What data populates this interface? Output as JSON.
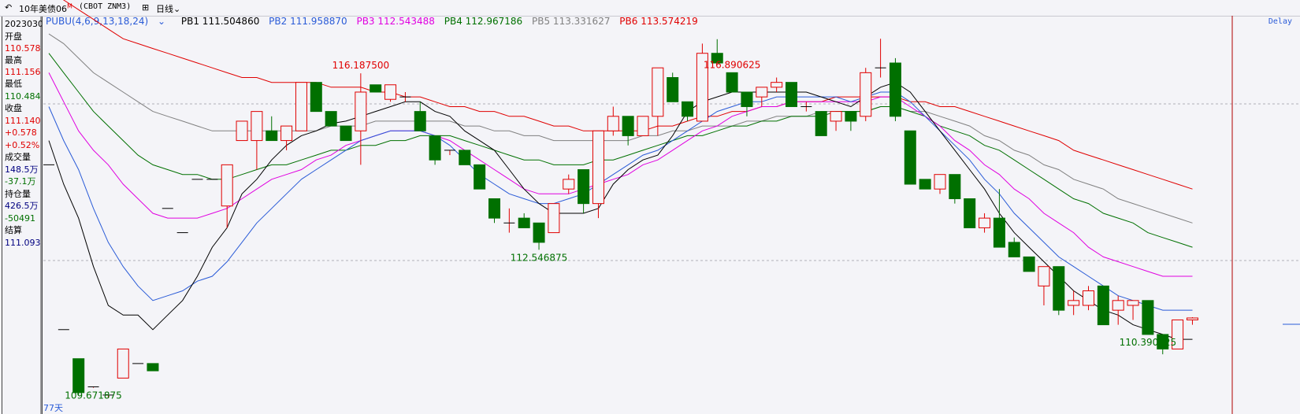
{
  "titlebar": {
    "back_glyph": "↶",
    "symbol": "10年美债06",
    "symbol_sup": "M",
    "code": "(CBOT ZNM3)",
    "grid_glyph": "⊞",
    "period": "日线",
    "period_arrow": "⌄"
  },
  "info_panel": {
    "date": "20230303",
    "open_label": "开盘",
    "open_value": "110.578",
    "high_label": "最高",
    "high_value": "111.156",
    "low_label": "最低",
    "low_value": "110.484",
    "close_label": "收盘",
    "close_value": "111.140",
    "change": "+0.578",
    "change_pct": "+0.52%",
    "volume_label": "成交量",
    "volume_value": "148.5万",
    "volume_change": "-37.1万",
    "oi_label": "持仓量",
    "oi_value": "426.5万",
    "oi_change": "-50491",
    "settle_label": "结算",
    "settle_value": "111.093"
  },
  "legend": {
    "indicator": "PUBU(4,6,9,13,18,24)",
    "items": [
      {
        "label": "PB1 111.504860",
        "color": "#000000"
      },
      {
        "label": "PB2 111.958870",
        "color": "#2a5bd7"
      },
      {
        "label": "PB3 112.543488",
        "color": "#e000e0"
      },
      {
        "label": "PB4 112.967186",
        "color": "#007000"
      },
      {
        "label": "PB5 113.331627",
        "color": "#808080"
      },
      {
        "label": "PB6 113.574219",
        "color": "#e00000"
      }
    ]
  },
  "delay_label": "Delay",
  "days_label": "77天",
  "colors": {
    "up": "#e00000",
    "down": "#007000",
    "pb1": "#000000",
    "pb2": "#2a5bd7",
    "pb3": "#e000e0",
    "pb4": "#007000",
    "pb5": "#808080",
    "pb6": "#e00000",
    "crosshair": "#b00000"
  },
  "chart_data": {
    "type": "candlestick",
    "price_range": [
      109.5,
      117.05
    ],
    "annotations": [
      {
        "label": "116.187500",
        "candle": 21,
        "kind": "high",
        "color": "#e00000"
      },
      {
        "label": "112.546875",
        "candle": 33,
        "kind": "low",
        "color": "#007000"
      },
      {
        "label": "116.890625",
        "candle": 46,
        "kind": "high",
        "color": "#e00000"
      },
      {
        "label": "109.671875",
        "candle": 3,
        "kind": "low",
        "color": "#007000"
      },
      {
        "label": "110.390625",
        "candle": 74,
        "kind": "low",
        "color": "#007000"
      }
    ],
    "candles": [
      [
        114.3,
        114.3,
        114.3,
        114.3
      ],
      [
        110.9,
        110.9,
        110.9,
        110.9
      ],
      [
        110.3,
        110.3,
        109.55,
        109.6
      ],
      [
        109.72,
        109.72,
        109.7,
        109.72
      ],
      [
        109.55,
        109.55,
        109.5,
        109.55
      ],
      [
        109.9,
        110.5,
        109.9,
        110.5
      ],
      [
        110.2,
        110.2,
        110.2,
        110.2
      ],
      [
        110.2,
        110.2,
        110.05,
        110.05
      ],
      [
        113.4,
        113.4,
        113.4,
        113.4
      ],
      [
        112.9,
        112.9,
        112.9,
        112.9
      ],
      [
        114.0,
        114.0,
        114.0,
        114.0
      ],
      [
        114.0,
        114.0,
        114.0,
        114.0
      ],
      [
        113.45,
        114.3,
        113.0,
        114.3
      ],
      [
        114.8,
        115.2,
        114.8,
        115.2
      ],
      [
        114.8,
        115.4,
        114.2,
        115.4
      ],
      [
        115.0,
        115.3,
        114.8,
        114.8
      ],
      [
        114.8,
        115.1,
        114.6,
        115.1
      ],
      [
        115.0,
        116.0,
        115.0,
        116.0
      ],
      [
        116.0,
        116.0,
        115.4,
        115.4
      ],
      [
        115.4,
        115.4,
        115.1,
        115.1
      ],
      [
        115.1,
        115.1,
        114.8,
        114.8
      ],
      [
        115.0,
        116.187,
        114.3,
        115.8
      ],
      [
        115.95,
        115.95,
        115.8,
        115.8
      ],
      [
        115.65,
        115.95,
        115.6,
        115.95
      ],
      [
        115.7,
        115.8,
        115.6,
        115.7
      ],
      [
        115.4,
        115.6,
        115.0,
        115.0
      ],
      [
        114.9,
        114.9,
        114.3,
        114.4
      ],
      [
        114.6,
        114.6,
        114.5,
        114.6
      ],
      [
        114.6,
        114.6,
        114.3,
        114.3
      ],
      [
        114.3,
        114.3,
        113.8,
        113.8
      ],
      [
        113.6,
        113.6,
        113.1,
        113.2
      ],
      [
        113.1,
        113.4,
        112.9,
        113.1
      ],
      [
        113.2,
        113.3,
        113.0,
        113.0
      ],
      [
        113.1,
        113.1,
        112.547,
        112.7
      ],
      [
        112.9,
        113.5,
        112.9,
        113.5
      ],
      [
        113.8,
        114.1,
        113.7,
        114.0
      ],
      [
        114.2,
        114.2,
        113.3,
        113.5
      ],
      [
        113.5,
        115.0,
        113.2,
        115.0
      ],
      [
        115.0,
        115.5,
        114.9,
        115.3
      ],
      [
        115.3,
        115.3,
        114.7,
        114.9
      ],
      [
        114.9,
        115.3,
        114.9,
        115.3
      ],
      [
        115.3,
        116.3,
        114.9,
        116.3
      ],
      [
        116.1,
        116.2,
        115.6,
        115.6
      ],
      [
        115.6,
        115.6,
        115.2,
        115.3
      ],
      [
        115.2,
        116.8,
        115.2,
        116.6
      ],
      [
        116.6,
        116.891,
        116.4,
        116.4
      ],
      [
        116.2,
        116.2,
        115.8,
        115.8
      ],
      [
        115.8,
        115.8,
        115.3,
        115.5
      ],
      [
        115.7,
        115.9,
        115.5,
        115.9
      ],
      [
        115.9,
        116.1,
        115.8,
        116.0
      ],
      [
        116.0,
        116.0,
        115.5,
        115.5
      ],
      [
        115.5,
        115.6,
        115.4,
        115.5
      ],
      [
        115.4,
        115.4,
        114.9,
        114.9
      ],
      [
        115.2,
        115.4,
        115.0,
        115.4
      ],
      [
        115.4,
        115.4,
        115.0,
        115.2
      ],
      [
        115.3,
        116.3,
        115.2,
        116.2
      ],
      [
        116.3,
        116.9,
        116.1,
        116.3
      ],
      [
        116.4,
        116.5,
        115.2,
        115.3
      ],
      [
        115.0,
        115.0,
        113.9,
        113.9
      ],
      [
        114.0,
        114.0,
        113.8,
        113.8
      ],
      [
        113.8,
        114.1,
        113.7,
        114.1
      ],
      [
        114.1,
        114.1,
        113.5,
        113.6
      ],
      [
        113.6,
        113.6,
        113.0,
        113.0
      ],
      [
        113.0,
        113.3,
        112.9,
        113.2
      ],
      [
        113.2,
        113.8,
        112.7,
        112.6
      ],
      [
        112.7,
        112.8,
        112.4,
        112.4
      ],
      [
        112.4,
        112.4,
        112.1,
        112.1
      ],
      [
        111.8,
        112.2,
        111.4,
        112.2
      ],
      [
        112.2,
        112.2,
        111.2,
        111.3
      ],
      [
        111.4,
        111.7,
        111.2,
        111.5
      ],
      [
        111.4,
        111.8,
        111.3,
        111.7
      ],
      [
        111.8,
        111.8,
        111.0,
        111.0
      ],
      [
        111.3,
        111.6,
        111.0,
        111.5
      ],
      [
        111.4,
        111.5,
        111.1,
        111.5
      ],
      [
        111.5,
        111.5,
        110.8,
        110.8
      ],
      [
        110.8,
        110.8,
        110.391,
        110.5
      ],
      [
        110.5,
        111.1,
        110.5,
        111.1
      ],
      [
        111.1,
        111.156,
        111.0,
        111.14
      ]
    ],
    "lines": {
      "pb1": [
        114.8,
        113.9,
        113.2,
        112.2,
        111.4,
        111.2,
        111.2,
        110.9,
        111.2,
        111.5,
        112.0,
        112.6,
        113.0,
        113.7,
        114.0,
        114.4,
        114.7,
        114.9,
        115.0,
        115.15,
        115.2,
        115.3,
        115.4,
        115.5,
        115.6,
        115.6,
        115.4,
        115.3,
        115.0,
        114.8,
        114.6,
        114.2,
        113.8,
        113.5,
        113.3,
        113.3,
        113.3,
        113.4,
        113.9,
        114.2,
        114.4,
        114.5,
        114.9,
        115.4,
        115.6,
        115.7,
        115.8,
        115.8,
        115.8,
        115.8,
        115.8,
        115.8,
        115.7,
        115.6,
        115.5,
        115.7,
        115.9,
        116.0,
        115.8,
        115.4,
        115.0,
        114.6,
        114.2,
        113.8,
        113.3,
        112.9,
        112.6,
        112.3,
        112.0,
        111.7,
        111.5,
        111.3,
        111.2,
        111.0,
        110.9,
        110.8,
        110.7,
        110.7
      ],
      "pb2": [
        115.5,
        114.8,
        114.2,
        113.4,
        112.7,
        112.2,
        111.8,
        111.5,
        111.6,
        111.7,
        111.9,
        112.0,
        112.3,
        112.7,
        113.1,
        113.4,
        113.7,
        114.0,
        114.2,
        114.4,
        114.6,
        114.8,
        114.9,
        115.0,
        115.0,
        115.0,
        114.9,
        114.7,
        114.4,
        114.1,
        113.9,
        113.7,
        113.6,
        113.5,
        113.5,
        113.6,
        113.7,
        113.9,
        114.1,
        114.3,
        114.5,
        114.6,
        114.8,
        115.0,
        115.2,
        115.4,
        115.5,
        115.6,
        115.6,
        115.7,
        115.7,
        115.7,
        115.7,
        115.7,
        115.6,
        115.7,
        115.8,
        115.8,
        115.6,
        115.3,
        115.0,
        114.7,
        114.4,
        114.0,
        113.7,
        113.3,
        113.0,
        112.7,
        112.4,
        112.2,
        112.0,
        111.8,
        111.6,
        111.5,
        111.4,
        111.3,
        111.3,
        111.3
      ],
      "pb3": [
        116.2,
        115.6,
        115.0,
        114.6,
        114.3,
        113.9,
        113.6,
        113.3,
        113.2,
        113.2,
        113.2,
        113.3,
        113.4,
        113.6,
        113.8,
        114.0,
        114.1,
        114.2,
        114.4,
        114.5,
        114.7,
        114.8,
        114.9,
        115.0,
        115.0,
        115.0,
        114.9,
        114.8,
        114.6,
        114.4,
        114.2,
        114.0,
        113.8,
        113.7,
        113.7,
        113.7,
        113.8,
        113.9,
        114.0,
        114.1,
        114.3,
        114.4,
        114.6,
        114.8,
        115.0,
        115.1,
        115.3,
        115.4,
        115.5,
        115.5,
        115.6,
        115.6,
        115.6,
        115.6,
        115.6,
        115.6,
        115.7,
        115.7,
        115.5,
        115.3,
        115.1,
        114.8,
        114.6,
        114.3,
        114.1,
        113.8,
        113.6,
        113.3,
        113.1,
        112.9,
        112.6,
        112.4,
        112.3,
        112.2,
        112.1,
        112.0,
        112.0,
        112.0
      ],
      "pb4": [
        116.6,
        116.2,
        115.8,
        115.4,
        115.1,
        114.8,
        114.5,
        114.3,
        114.2,
        114.1,
        114.1,
        114.0,
        114.0,
        114.1,
        114.2,
        114.3,
        114.3,
        114.4,
        114.5,
        114.6,
        114.6,
        114.7,
        114.7,
        114.8,
        114.8,
        114.9,
        114.9,
        114.9,
        114.8,
        114.7,
        114.6,
        114.5,
        114.4,
        114.4,
        114.3,
        114.3,
        114.3,
        114.4,
        114.4,
        114.5,
        114.6,
        114.7,
        114.8,
        114.9,
        114.9,
        115.0,
        115.1,
        115.1,
        115.2,
        115.2,
        115.3,
        115.3,
        115.3,
        115.4,
        115.4,
        115.4,
        115.5,
        115.5,
        115.4,
        115.3,
        115.1,
        115.0,
        114.9,
        114.7,
        114.6,
        114.4,
        114.2,
        114.0,
        113.8,
        113.6,
        113.5,
        113.3,
        113.2,
        113.1,
        112.9,
        112.8,
        112.7,
        112.6
      ],
      "pb5": [
        117.0,
        116.8,
        116.5,
        116.2,
        116.0,
        115.8,
        115.6,
        115.4,
        115.3,
        115.2,
        115.1,
        115.0,
        115.0,
        115.0,
        115.0,
        115.0,
        115.0,
        115.0,
        115.0,
        115.1,
        115.1,
        115.1,
        115.2,
        115.2,
        115.2,
        115.2,
        115.2,
        115.2,
        115.1,
        115.1,
        115.0,
        115.0,
        114.9,
        114.9,
        114.8,
        114.8,
        114.8,
        114.8,
        114.8,
        114.8,
        114.9,
        114.9,
        115.0,
        115.0,
        115.1,
        115.1,
        115.1,
        115.2,
        115.2,
        115.3,
        115.3,
        115.3,
        115.4,
        115.4,
        115.4,
        115.4,
        115.5,
        115.5,
        115.4,
        115.4,
        115.3,
        115.2,
        115.1,
        114.9,
        114.8,
        114.6,
        114.5,
        114.3,
        114.2,
        114.0,
        113.9,
        113.8,
        113.6,
        113.5,
        113.4,
        113.3,
        113.2,
        113.1
      ],
      "pb6": [
        117.9,
        117.7,
        117.5,
        117.3,
        117.1,
        116.9,
        116.8,
        116.7,
        116.6,
        116.5,
        116.4,
        116.3,
        116.2,
        116.1,
        116.1,
        116.0,
        116.0,
        116.0,
        116.0,
        115.9,
        115.9,
        115.9,
        115.8,
        115.8,
        115.7,
        115.7,
        115.6,
        115.5,
        115.5,
        115.4,
        115.4,
        115.3,
        115.3,
        115.2,
        115.1,
        115.1,
        115.0,
        115.0,
        115.0,
        115.0,
        115.0,
        115.1,
        115.1,
        115.2,
        115.3,
        115.3,
        115.4,
        115.4,
        115.5,
        115.5,
        115.6,
        115.6,
        115.6,
        115.7,
        115.7,
        115.7,
        115.7,
        115.7,
        115.6,
        115.6,
        115.5,
        115.5,
        115.4,
        115.3,
        115.2,
        115.1,
        115.0,
        114.9,
        114.8,
        114.6,
        114.5,
        114.4,
        114.3,
        114.2,
        114.1,
        114.0,
        113.9,
        113.8
      ]
    }
  }
}
